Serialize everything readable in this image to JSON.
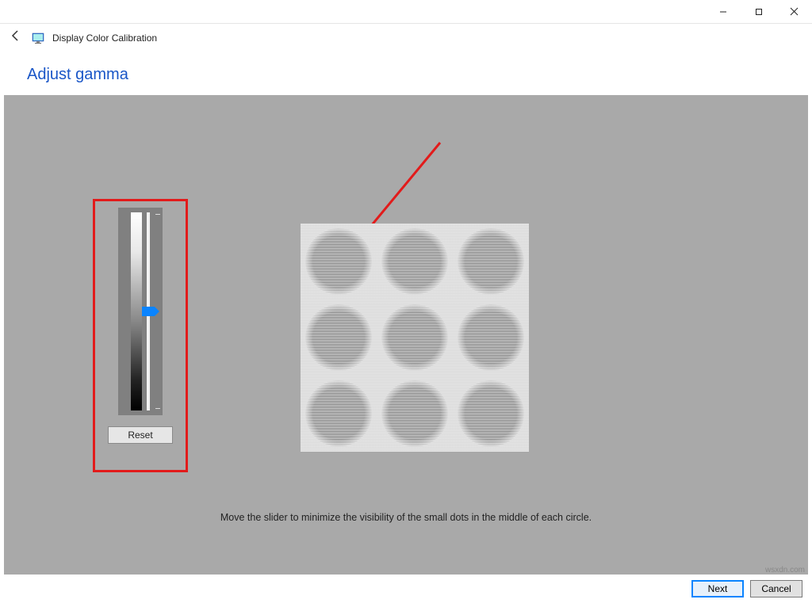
{
  "window": {
    "title": "Display Color Calibration"
  },
  "page": {
    "heading": "Adjust gamma",
    "instruction": "Move the slider to minimize the visibility of the small dots in the middle of each circle."
  },
  "slider": {
    "reset_label": "Reset"
  },
  "buttons": {
    "next": "Next",
    "cancel": "Cancel"
  },
  "watermark": "wsxdn.com"
}
